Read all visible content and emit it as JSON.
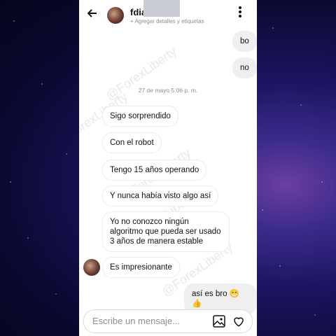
{
  "header": {
    "back_glyph": "🡐",
    "name": "fdia",
    "subtitle": "+ Agregar detalles y etiquetas",
    "more_glyph": "⋮"
  },
  "watermark": "@ForexLiberty",
  "messages_top": [
    {
      "text": "bo",
      "direction": "outgoing"
    },
    {
      "text": "no",
      "direction": "outgoing"
    }
  ],
  "date_divider": "27 de mayo 5:06 p. m.",
  "messages": [
    {
      "text": "Sigo sorprendido",
      "direction": "incoming"
    },
    {
      "text": "Con el robot",
      "direction": "incoming"
    },
    {
      "text": "Tengo 15 años operando",
      "direction": "incoming"
    },
    {
      "text": "Y nunca había visto algo así",
      "direction": "incoming"
    },
    {
      "text": "Yo no conozco ningún algoritmo que pueda ser usado 3 años de manera estable",
      "direction": "incoming"
    },
    {
      "text": "Es impresionante",
      "direction": "incoming"
    },
    {
      "text": "así es bro 😁👍",
      "direction": "outgoing"
    }
  ],
  "composer": {
    "placeholder": "Escribe un mensaje..."
  },
  "icons": [
    "back-arrow-icon",
    "more-vertical-icon",
    "image-icon",
    "heart-icon"
  ]
}
